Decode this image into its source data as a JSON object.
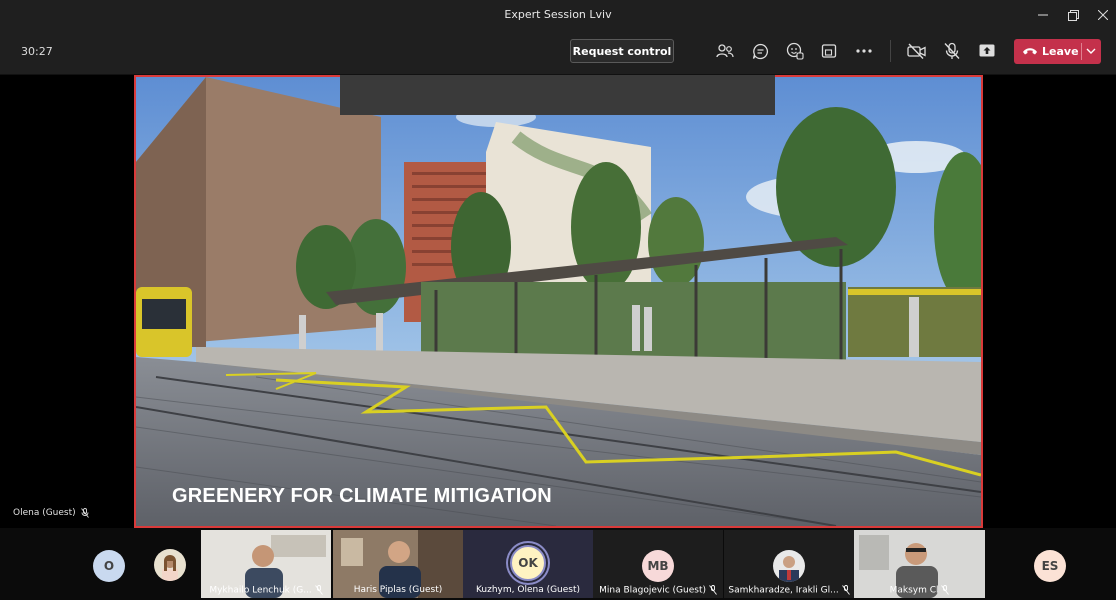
{
  "window": {
    "title": "Expert Session Lviv"
  },
  "toolbar": {
    "timer": "30:27",
    "request_control_label": "Request control",
    "leave_label": "Leave"
  },
  "share": {
    "slide_caption": "GREENERY FOR CLIMATE MITIGATION",
    "presenter_name": "Olena (Guest)"
  },
  "gallery": {
    "avatar_o": "O",
    "participants": [
      {
        "name": "Mykhailo Lenchuk (G..."
      },
      {
        "name": "Haris Piplas (Guest)"
      },
      {
        "name": "Kuzhym, Olena (Guest)",
        "initials": "OK"
      },
      {
        "name": "Mina Blagojevic (Guest)",
        "initials": "MB"
      },
      {
        "name": "Samkharadze, Irakli Gl..."
      },
      {
        "name": "Maksym Cl"
      }
    ],
    "avatar_es": "ES"
  },
  "colors": {
    "leave": "#c4314b",
    "share_border": "#d93a3a",
    "accent": "#6264a7"
  }
}
